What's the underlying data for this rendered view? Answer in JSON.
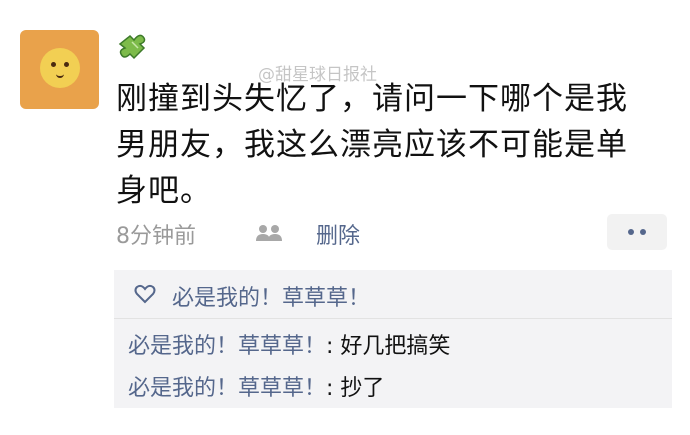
{
  "post": {
    "text": "刚撞到头失忆了，请问一下哪个是我男朋友，我这么漂亮应该不可能是单身吧。",
    "time": "8分钟前",
    "delete_label": "删除"
  },
  "watermark": "@甜星球日报社",
  "likes": {
    "names": "必是我的！草草草！"
  },
  "comments": [
    {
      "author": "必是我的！草草草！",
      "separator": ": ",
      "text": "好几把搞笑"
    },
    {
      "author": "必是我的！草草草！",
      "separator": ": ",
      "text": "抄了"
    }
  ],
  "colors": {
    "link": "#55678c",
    "meta": "#9a9a9a",
    "comment_bg": "#f3f3f5"
  },
  "icons": [
    "avatar-flower",
    "puzzle-icon",
    "people-icon",
    "more-icon",
    "heart-icon"
  ]
}
